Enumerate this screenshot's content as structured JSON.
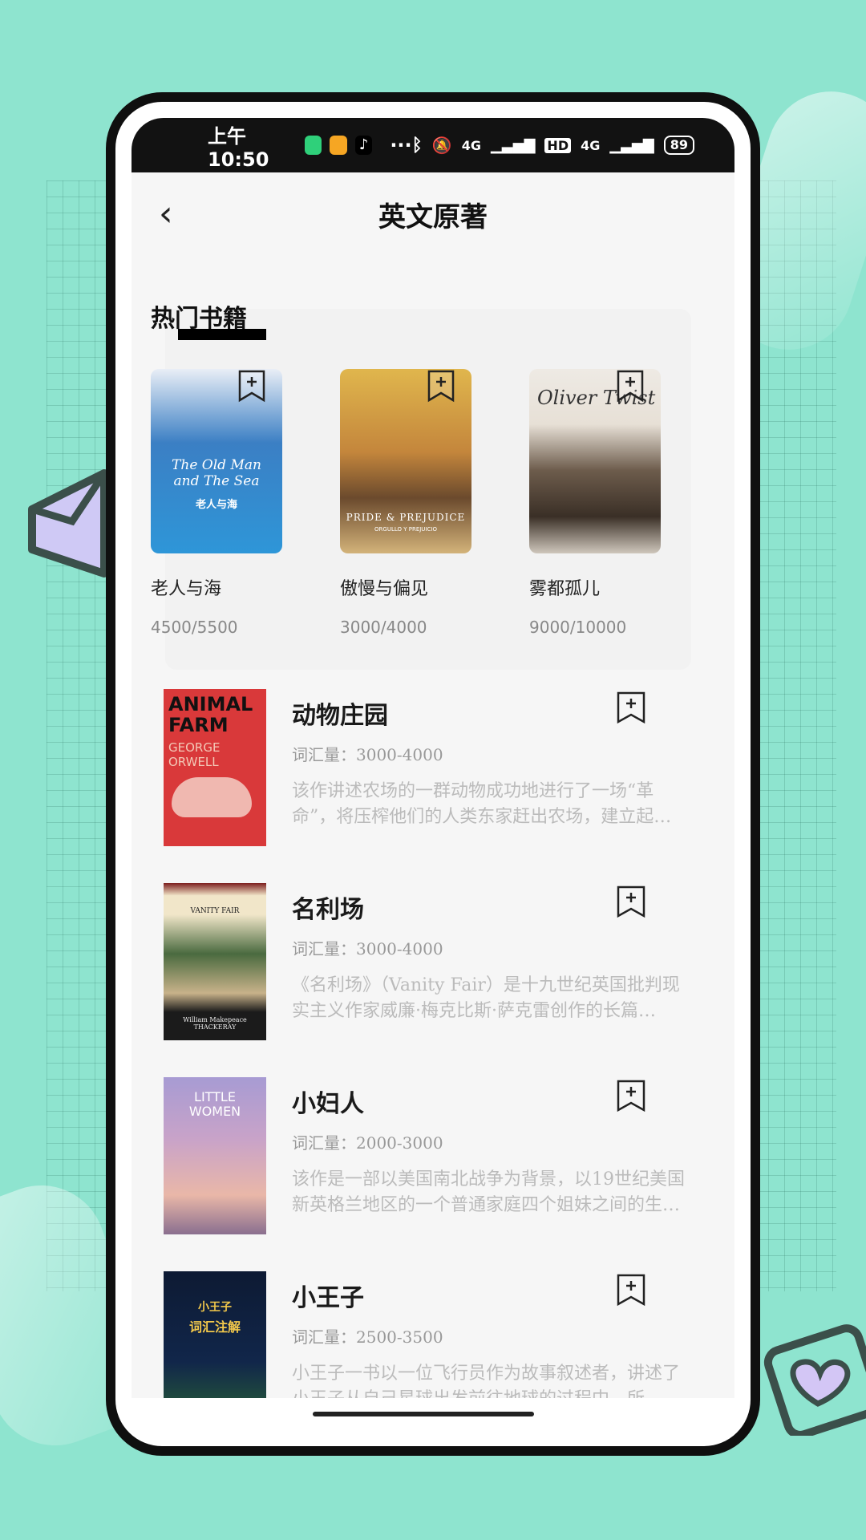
{
  "status": {
    "time": "上午10:50",
    "dots": "···",
    "net1": "4G",
    "hd": "HD",
    "net2": "4G",
    "battery": "89"
  },
  "header": {
    "back_icon": "‹",
    "title": "英文原著"
  },
  "hot": {
    "title": "热门书籍",
    "books": [
      {
        "name": "老人与海",
        "count": "4500/5500",
        "cover_title": "The Old Man and The Sea",
        "cover_sub": "老人与海"
      },
      {
        "name": "傲慢与偏见",
        "count": "3000/4000",
        "cover_title": "PRIDE & PREJUDICE",
        "cover_sub": "ORGULLO Y PREJUICIO"
      },
      {
        "name": "雾都孤儿",
        "count": "9000/10000",
        "cover_title": "Oliver Twist",
        "cover_sub": ""
      }
    ]
  },
  "list": [
    {
      "name": "动物庄园",
      "vocab": "词汇量：3000-4000",
      "desc": "该作讲述农场的一群动物成功地进行了一场“革命”，将压榨他们的人类东家赶出农场，建立起…",
      "cover_title": "ANIMAL FARM",
      "cover_author": "GEORGE ORWELL"
    },
    {
      "name": "名利场",
      "vocab": "词汇量：3000-4000",
      "desc": "《名利场》（Vanity Fair）是十九世纪英国批判现实主义作家威廉·梅克比斯·萨克雷创作的长篇…",
      "cover_title": "VANITY FAIR",
      "cover_author": "William Makepeace THACKERAY"
    },
    {
      "name": "小妇人",
      "vocab": "词汇量：2000-3000",
      "desc": "该作是一部以美国南北战争为背景，以19世纪美国新英格兰地区的一个普通家庭四个姐妹之间的生…",
      "cover_title": "LITTLE WOMEN",
      "cover_author": ""
    },
    {
      "name": "小王子",
      "vocab": "词汇量：2500-3500",
      "desc": "小王子一书以一位飞行员作为故事叙述者，讲述了小王子从自己星球出发前往地球的过程中，所 …",
      "cover_title": "小王子",
      "cover_author": "词汇注解"
    }
  ]
}
